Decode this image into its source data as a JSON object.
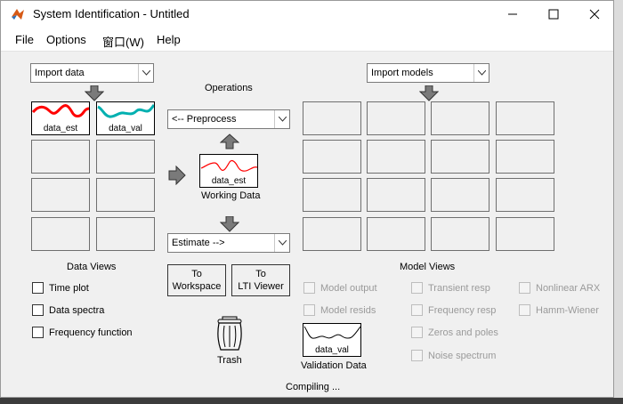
{
  "window": {
    "title": "System Identification - Untitled"
  },
  "menu": {
    "file": "File",
    "options": "Options",
    "window": "窗口(W)",
    "help": "Help"
  },
  "left": {
    "import_data_value": "Import data",
    "data_slots": [
      "data_est",
      "data_val"
    ],
    "data_views_label": "Data Views",
    "views": [
      "Time plot",
      "Data spectra",
      "Frequency function"
    ]
  },
  "center": {
    "operations_label": "Operations",
    "preprocess_value": "<-- Preprocess",
    "working_data_name": "data_est",
    "working_data_label": "Working Data",
    "estimate_value": "Estimate -->",
    "to_workspace": "To\nWorkspace",
    "to_lti": "To\nLTI Viewer",
    "trash_label": "Trash"
  },
  "right": {
    "import_models_value": "Import models",
    "model_views_label": "Model Views",
    "views_col1": [
      "Model output",
      "Model resids"
    ],
    "views_col2": [
      "Transient resp",
      "Frequency resp",
      "Zeros and poles",
      "Noise spectrum"
    ],
    "views_col3": [
      "Nonlinear ARX",
      "Hamm-Wiener"
    ],
    "validation_data_name": "data_val",
    "validation_data_label": "Validation Data"
  },
  "status": {
    "text": "Compiling ..."
  },
  "colors": {
    "data_est": "#ff0000",
    "data_val": "#00b0b0"
  },
  "icons": {
    "app": "matlab-icon",
    "minimize": "minimize-icon",
    "maximize": "maximize-icon",
    "close": "close-icon"
  }
}
